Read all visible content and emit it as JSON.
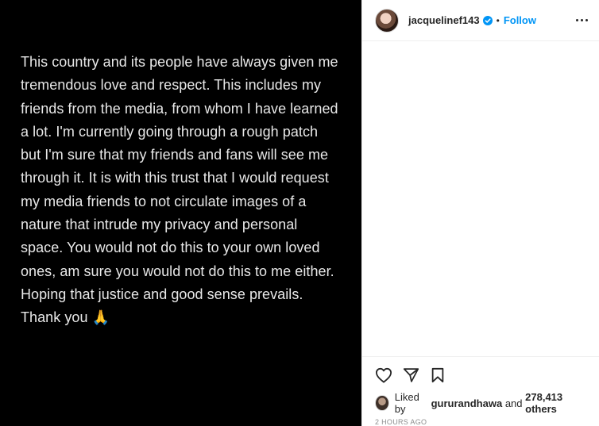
{
  "post": {
    "media_text": "This country and its people have always given me tremendous love and respect. This includes my friends from the media, from whom I have learned a lot. I'm currently going through a rough patch but I'm sure that my friends and fans will see me through it. It is with this trust that I would request my media friends to not circulate images of a nature that intrude my privacy and personal space. You would not do this to your own loved ones, am sure you would not do this to me either. Hoping that justice and good sense prevails. Thank you",
    "media_emoji": "🙏"
  },
  "header": {
    "username": "jacquelinef143",
    "separator": "•",
    "follow_label": "Follow",
    "verified_color": "#0095f6"
  },
  "actions": {
    "like_icon": "heart-icon",
    "share_icon": "paper-plane-icon",
    "save_icon": "bookmark-icon"
  },
  "likes": {
    "prefix": "Liked by",
    "user": "gururandhawa",
    "conjunction": "and",
    "count": "278,413 others"
  },
  "timestamp": "2 HOURS AGO"
}
